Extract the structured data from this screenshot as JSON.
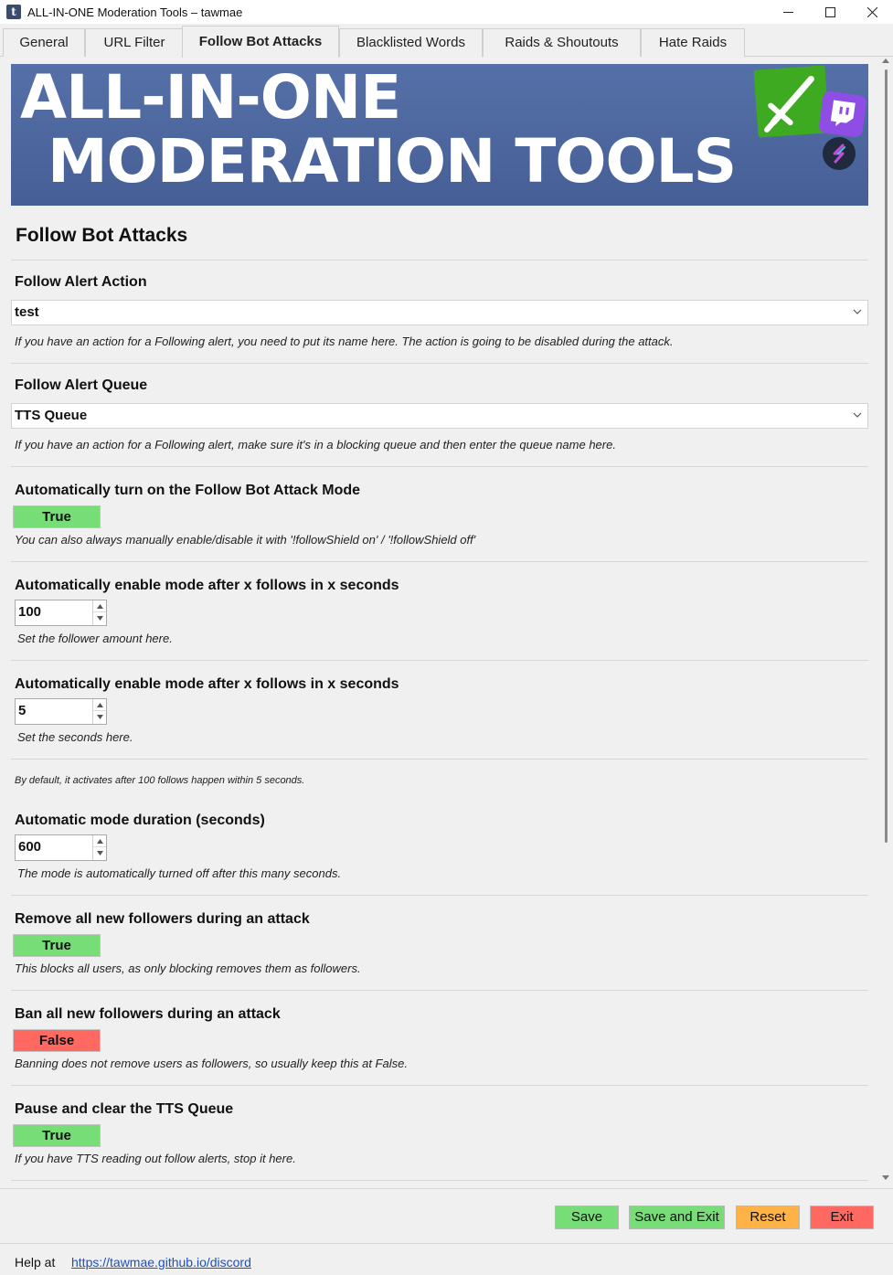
{
  "window": {
    "title": "ALL-IN-ONE Moderation Tools – tawmae",
    "app_icon_glyph": "t"
  },
  "tabs": [
    {
      "label": "General"
    },
    {
      "label": "URL Filter"
    },
    {
      "label": "Follow Bot Attacks",
      "active": true
    },
    {
      "label": "Blacklisted Words"
    },
    {
      "label": "Raids & Shoutouts"
    },
    {
      "label": "Hate Raids"
    }
  ],
  "banner": {
    "line1": "ALL-IN-ONE",
    "line2": "MODERATION TOOLS",
    "icons": [
      "sword-icon",
      "twitch-icon",
      "streamerbot-icon"
    ]
  },
  "page": {
    "title": "Follow Bot Attacks"
  },
  "fields": {
    "follow_alert_action": {
      "label": "Follow Alert Action",
      "value": "test",
      "hint": "If you have an action for a Following alert, you need to put its name here. The action is going to be disabled during the attack."
    },
    "follow_alert_queue": {
      "label": "Follow Alert Queue",
      "value": "TTS Queue",
      "hint": "If you have an action for a Following alert, make sure it's in a blocking queue and then enter the queue name here."
    },
    "auto_turn_on": {
      "label": "Automatically turn on the Follow Bot Attack Mode",
      "value": "True",
      "hint": "You can also always manually enable/disable it with '!followShield on' / '!followShield off'"
    },
    "follow_amount": {
      "label": "Automatically enable mode after x follows in x seconds",
      "value": "100",
      "hint": "Set the follower amount here."
    },
    "follow_seconds": {
      "label": "Automatically enable mode after x follows in x seconds",
      "value": "5",
      "hint": "Set the seconds here."
    },
    "default_note": "By default, it activates after 100 follows happen within 5 seconds.",
    "mode_duration": {
      "label": "Automatic mode duration (seconds)",
      "value": "600",
      "hint": "The mode is automatically turned off after this many seconds."
    },
    "remove_followers": {
      "label": "Remove all new followers during an attack",
      "value": "True",
      "hint": "This blocks all users, as only blocking removes them as followers."
    },
    "ban_followers": {
      "label": "Ban all new followers during an attack",
      "value": "False",
      "hint": "Banning does not remove users as followers, so usually keep this at False."
    },
    "pause_tts": {
      "label": "Pause and clear the TTS Queue",
      "value": "True",
      "hint": "If you have TTS reading out follow alerts, stop it here."
    }
  },
  "buttons": {
    "save": "Save",
    "save_exit": "Save and Exit",
    "reset": "Reset",
    "exit": "Exit"
  },
  "footer": {
    "help_label": "Help at",
    "help_link": "https://tawmae.github.io/discord"
  },
  "colors": {
    "true_green": "#77dd77",
    "false_red": "#ff6961",
    "reset_orange": "#ffb347",
    "banner_blue": "#4f6aa3",
    "link_blue": "#1a4fc4"
  }
}
